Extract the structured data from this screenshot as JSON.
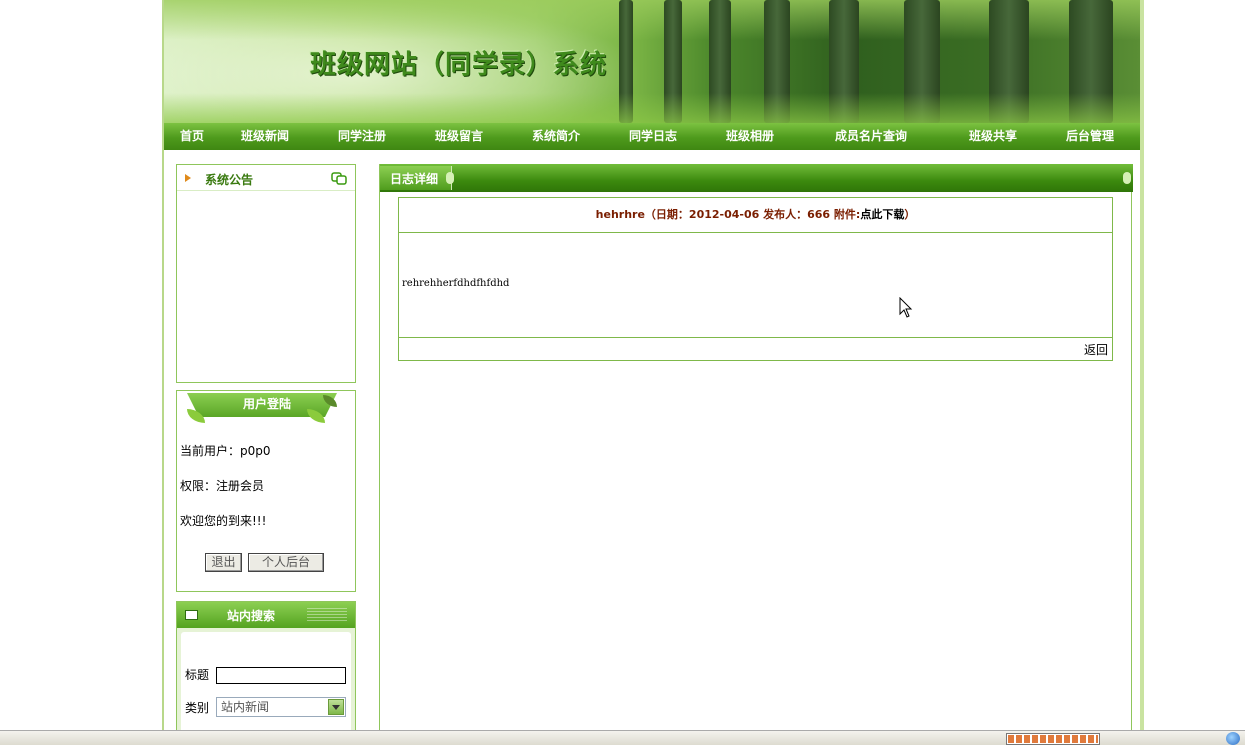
{
  "header": {
    "site_title": "班级网站（同学录）系统"
  },
  "nav": [
    {
      "label": "首页"
    },
    {
      "label": "班级新闻"
    },
    {
      "label": "同学注册"
    },
    {
      "label": "班级留言"
    },
    {
      "label": "系统简介"
    },
    {
      "label": "同学日志"
    },
    {
      "label": "班级相册"
    },
    {
      "label": "成员名片查询"
    },
    {
      "label": "班级共享"
    },
    {
      "label": "后台管理"
    }
  ],
  "notice": {
    "title": "系统公告"
  },
  "login": {
    "title": "用户登陆",
    "current_user": "当前用户：p0p0",
    "role": "权限：注册会员",
    "welcome": "欢迎您的到来!!!",
    "logout_label": "退出",
    "profile_label": "个人后台"
  },
  "search": {
    "title": "站内搜索",
    "title_label": "标题",
    "category_label": "类别",
    "title_value": "",
    "category_value": "站内新闻"
  },
  "main": {
    "panel_title": "日志详细",
    "entry_heading": "hehrhre（日期：2012-04-06 发布人：666 附件:",
    "download_label": "点此下载",
    "entry_heading_close": "）",
    "content": "rehrehherfdhdfhfdhd",
    "back_label": "返回"
  },
  "colors": {
    "nav_green": "#4e9a1c",
    "border_green": "#8fc65b",
    "title_brown": "#7a1e00"
  }
}
